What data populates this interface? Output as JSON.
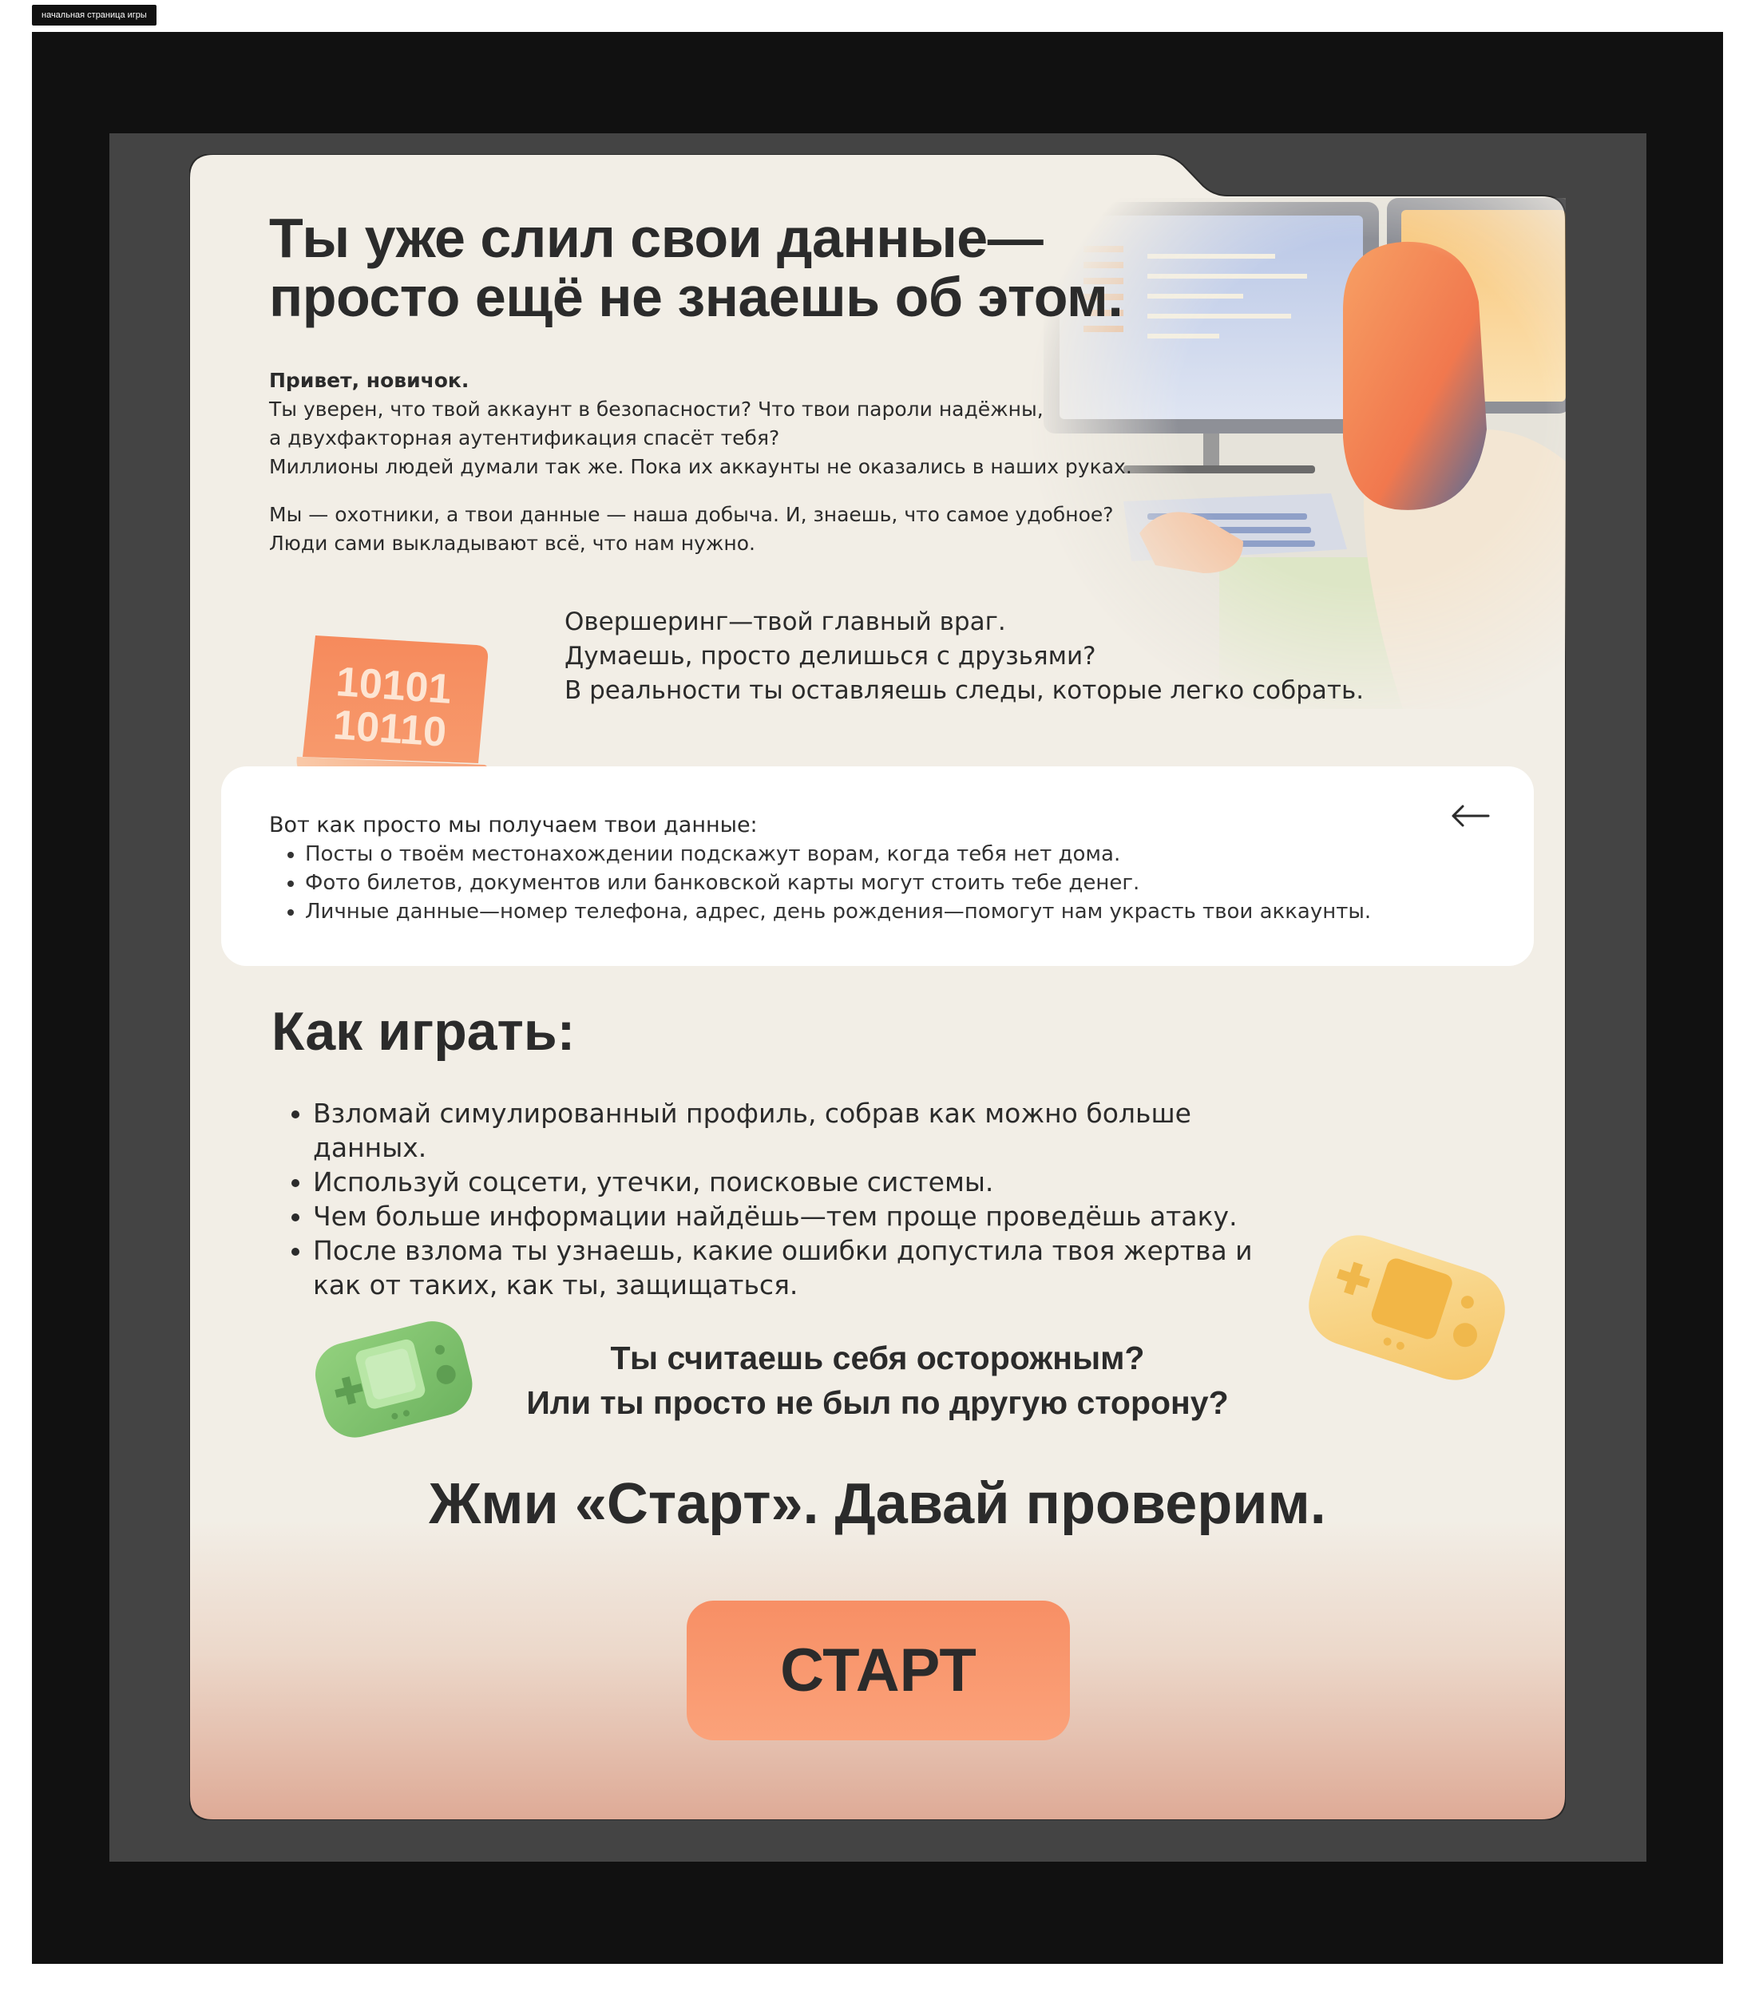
{
  "frame": {
    "label": "начальная страница игры"
  },
  "colors": {
    "outer_bg": "#111111",
    "inner_bg": "#444444",
    "card_bg": "#f2eee6",
    "card_bottom": "#deaa96",
    "accent_orange": "#f78f65",
    "text": "#2b2b2b",
    "green_console": "#7bc26a",
    "yellow_console": "#f7cc6a"
  },
  "hero": {
    "title_line1": "Ты уже слил свои данные—",
    "title_line2": "просто ещё не знаешь об этом."
  },
  "intro": {
    "greeting": "Привет, новичок.",
    "line1": "Ты уверен, что твой аккаунт в безопасности? Что твои пароли надёжны,",
    "line2": "а двухфакторная аутентификация спасёт тебя?",
    "line3": "Миллионы людей думали так же. Пока их аккаунты не оказались в наших руках.",
    "line4": "Мы — охотники, а твои данные — наша добыча. И, знаешь, что самое удобное?",
    "line5": "Люди сами выкладывают всё, что нам нужно."
  },
  "binary_badge": {
    "line1": "10101",
    "line2": "10110"
  },
  "oversharing": {
    "line1": "Овершеринг—твой главный враг.",
    "line2": "Думаешь, просто делишься с друзьями?",
    "line3": "В реальности ты оставляешь следы, которые легко собрать."
  },
  "info_box": {
    "title": "Вот как просто мы получаем твои данные:",
    "items": [
      "Посты о твоём местонахождении подскажут ворам, когда тебя нет дома.",
      "Фото билетов, документов или банковской карты могут стоить тебе денег.",
      "Личные данные—номер телефона, адрес, день рождения—помогут нам украсть твои аккаунты."
    ],
    "back_icon": "arrow-left-icon"
  },
  "how_to_play": {
    "title": "Как играть:",
    "items": [
      "Взломай симулированный профиль, собрав как можно больше данных.",
      "Используй соцсети, утечки, поисковые системы.",
      "Чем больше информации найдёшь—тем проще проведёшь атаку.",
      "После взлома ты узнаешь, какие ошибки допустила твоя жертва и как от таких, как ты, защищаться."
    ]
  },
  "question": {
    "line1": "Ты считаешь себя осторожным?",
    "line2": "Или ты просто не был по другую сторону?"
  },
  "cta": {
    "text": "Жми «Старт». Давай проверим.",
    "button_label": "СТАРТ"
  }
}
